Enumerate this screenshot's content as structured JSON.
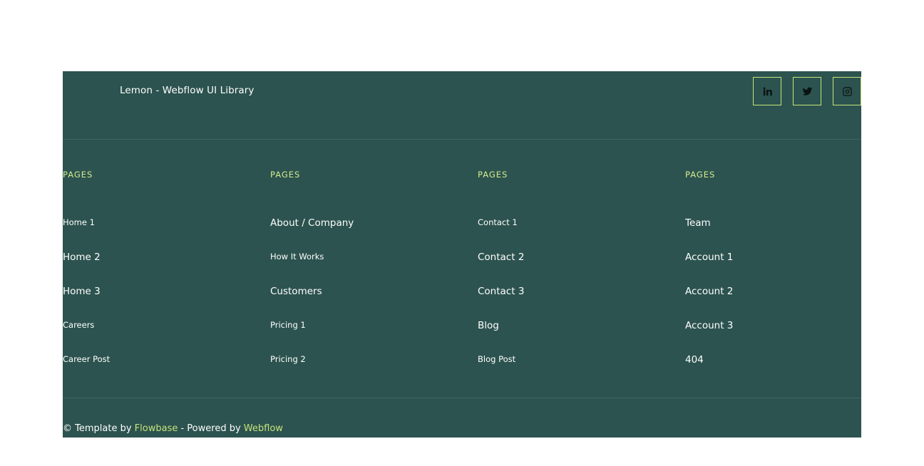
{
  "header": {
    "brand": "Lemon - Webflow UI Library",
    "social": [
      {
        "icon": "linkedin-icon"
      },
      {
        "icon": "twitter-icon"
      },
      {
        "icon": "instagram-icon"
      }
    ]
  },
  "columns": [
    {
      "title": "PAGES",
      "links": [
        "Home 1",
        "Home 2",
        "Home 3",
        "Careers",
        "Career Post"
      ]
    },
    {
      "title": "PAGES",
      "links": [
        "About / Company",
        "How It Works",
        "Customers",
        "Pricing 1",
        "Pricing 2"
      ]
    },
    {
      "title": "PAGES",
      "links": [
        "Contact 1",
        "Contact 2",
        "Contact 3",
        "Blog",
        "Blog Post"
      ]
    },
    {
      "title": "PAGES",
      "links": [
        "Team",
        "Account 1",
        "Account 2",
        "Account 3",
        "404"
      ]
    }
  ],
  "footer": {
    "template_prefix": "© Template by ",
    "template_link": "Flowbase",
    "powered_prefix": "- Powered by ",
    "powered_link": "Webflow"
  },
  "colors": {
    "background": "#2c534f",
    "accent": "#c5e37a",
    "heading": "#d4ec8e"
  }
}
